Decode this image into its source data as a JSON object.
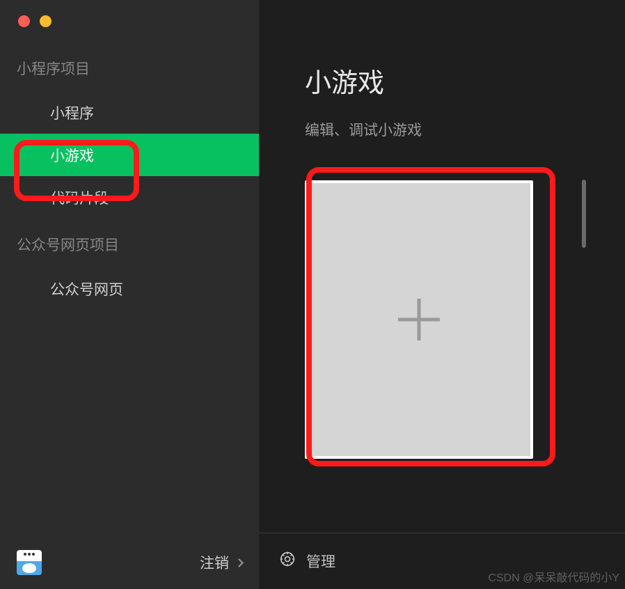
{
  "sidebar": {
    "sections": [
      {
        "header": "小程序项目",
        "items": [
          {
            "label": "小程序",
            "active": false
          },
          {
            "label": "小游戏",
            "active": true
          },
          {
            "label": "代码片段",
            "active": false
          }
        ]
      },
      {
        "header": "公众号网页项目",
        "items": [
          {
            "label": "公众号网页",
            "active": false
          }
        ]
      }
    ],
    "logout_label": "注销"
  },
  "main": {
    "title": "小游戏",
    "subtitle": "编辑、调试小游戏",
    "footer": {
      "manage_label": "管理"
    }
  },
  "watermark": "CSDN @呆呆敲代码的小Y",
  "colors": {
    "accent": "#07c160",
    "highlight": "#ff1a1a"
  }
}
